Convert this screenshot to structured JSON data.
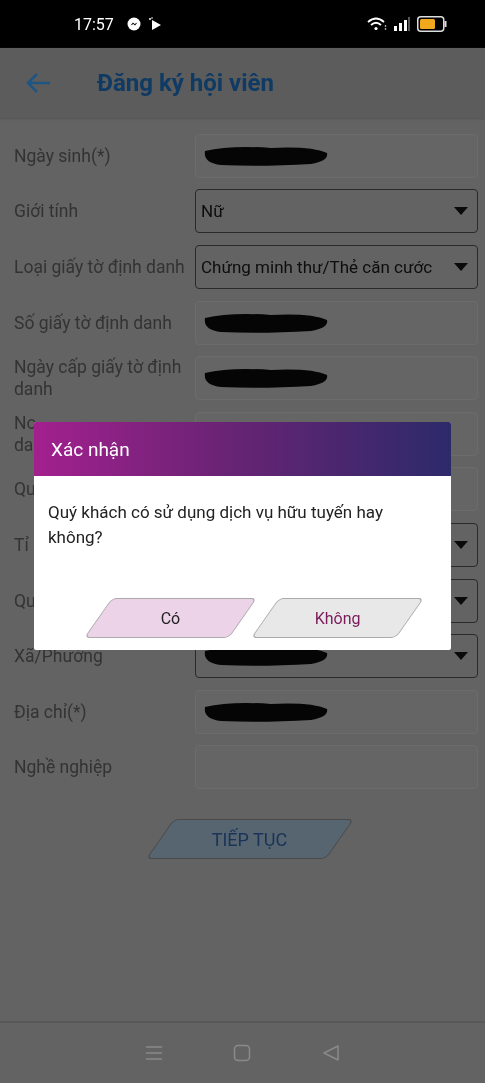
{
  "status_bar": {
    "time": "17:57"
  },
  "app_bar": {
    "title": "Đăng ký hội viên"
  },
  "form": [
    {
      "label": "Ngày sinh(*)",
      "kind": "input",
      "redacted": true
    },
    {
      "label": "Giới tính",
      "kind": "select",
      "value": "Nữ"
    },
    {
      "label": "Loại giấy tờ định danh",
      "kind": "select",
      "value": "Chứng minh thư/Thẻ căn cước"
    },
    {
      "label": "Số giấy tờ định danh",
      "kind": "input",
      "redacted": true
    },
    {
      "label": "Ngày cấp giấy tờ định danh",
      "kind": "input",
      "redacted": true
    },
    {
      "label": "No\nda",
      "kind": "input"
    },
    {
      "label": "Qu",
      "kind": "input"
    },
    {
      "label": "Tỉ",
      "kind": "select"
    },
    {
      "label": "Qu",
      "kind": "select"
    },
    {
      "label": "Xã/Phường",
      "kind": "select",
      "redacted": true
    },
    {
      "label": "Địa chỉ(*)",
      "kind": "input",
      "redacted": true
    },
    {
      "label": "Nghề nghiệp",
      "kind": "input"
    }
  ],
  "continue_button": "TIẾP TỤC",
  "dialog": {
    "title": "Xác nhận",
    "message": "Quý khách có sử dụng dịch vụ hữu tuyến hay không?",
    "buttons": [
      {
        "label": "Có",
        "kind": "primary"
      },
      {
        "label": "Không",
        "kind": "secondary"
      }
    ]
  }
}
